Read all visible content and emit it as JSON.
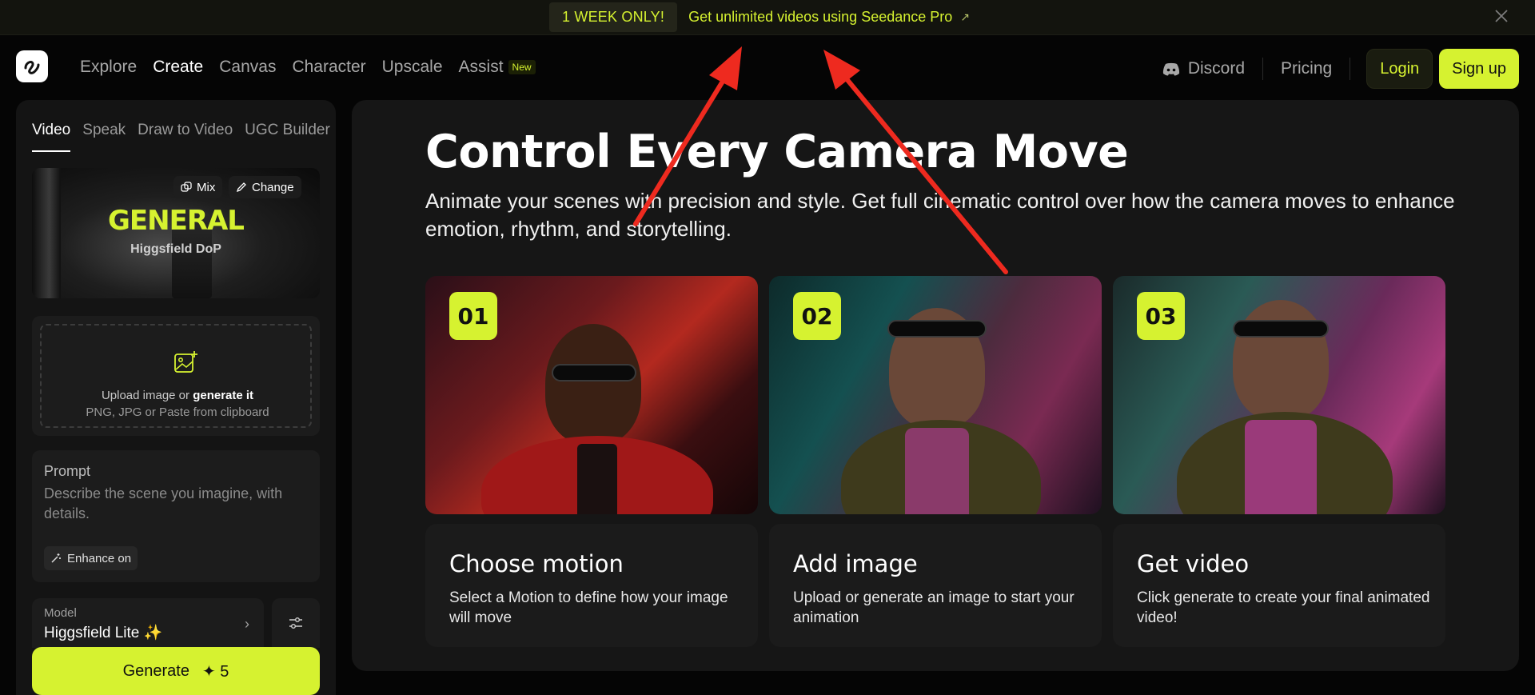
{
  "banner": {
    "badge": "1 WEEK ONLY!",
    "link_text": "Get unlimited videos using Seedance Pro",
    "arrow": "↗"
  },
  "nav": {
    "links": [
      "Explore",
      "Create",
      "Canvas",
      "Character",
      "Upscale",
      "Assist"
    ],
    "active": "Create",
    "new_badge": "New",
    "discord": "Discord",
    "pricing": "Pricing",
    "login": "Login",
    "signup": "Sign up"
  },
  "sidebar": {
    "tabs": [
      "Video",
      "Speak",
      "Draw to Video",
      "UGC Builder"
    ],
    "active_tab": "Video",
    "preset": {
      "mix_label": "Mix",
      "change_label": "Change",
      "title": "GENERAL",
      "subtitle": "Higgsfield DoP"
    },
    "upload": {
      "text_prefix": "Upload image or ",
      "text_bold": "generate it",
      "hint": "PNG, JPG or Paste from clipboard"
    },
    "prompt": {
      "label": "Prompt",
      "placeholder": "Describe the scene you imagine, with details.",
      "enhance_label": "Enhance on"
    },
    "model": {
      "label": "Model",
      "value": "Higgsfield Lite ✨"
    },
    "generate": {
      "label": "Generate",
      "cost": "✦ 5"
    }
  },
  "main": {
    "title": "Control Every Camera Move",
    "description": "Animate your scenes with precision and style. Get full cinematic control over how the camera moves to enhance emotion, rhythm, and storytelling.",
    "steps": [
      {
        "num": "01",
        "title": "Choose motion",
        "desc": "Select a Motion to define how your image will move"
      },
      {
        "num": "02",
        "title": "Add image",
        "desc": "Upload or generate an image to start your animation"
      },
      {
        "num": "03",
        "title": "Get video",
        "desc": "Click generate to create your final animated video!"
      }
    ]
  },
  "colors": {
    "accent": "#d6f230",
    "background": "#050505",
    "panel": "#161616",
    "annotation_arrow": "#ee2a1f"
  }
}
